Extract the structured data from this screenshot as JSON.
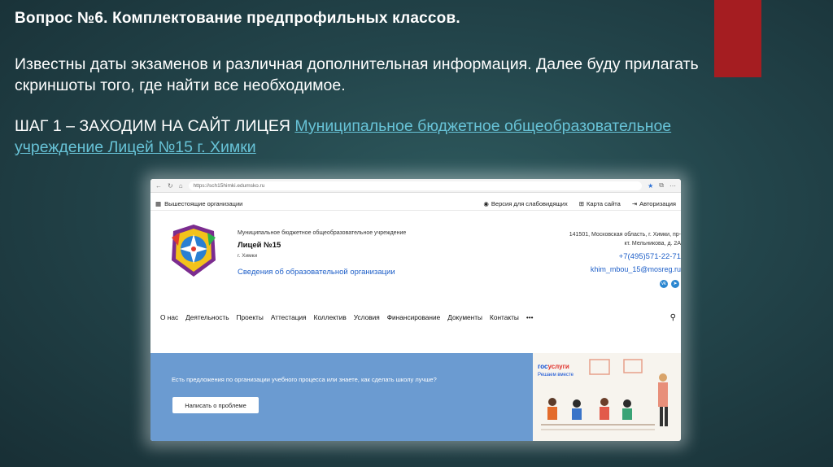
{
  "slide": {
    "title": "Вопрос №6. Комплектование предпрофильных классов.",
    "body": "Известны даты экзаменов и различная дополнительная информация. Далее буду прилагать скриншоты того, где найти все необходимое.",
    "step_prefix": "ШАГ 1 – ЗАХОДИМ НА САЙТ ЛИЦЕЯ ",
    "step_link": "Муниципальное бюджетное общеобразовательное учреждение Лицей №15 г. Химки",
    "accent_color": "#a51d21"
  },
  "browser": {
    "url": "https://sch15himki.edumsko.ru"
  },
  "site": {
    "top_strip": {
      "left": "Вышестоящие организации",
      "accessibility": "Версия для слабовидящих",
      "sitemap": "Карта сайта",
      "login": "Авторизация"
    },
    "header": {
      "org_type": "Муниципальное бюджетное общеобразовательное учреждение",
      "name": "Лицей №15",
      "city": "г. Химки",
      "info_link": "Сведения об образовательной организации",
      "address_line1": "141501, Московская область, г. Химки, пр-",
      "address_line2": "кт. Мельникова, д. 2А",
      "phone": "+7(495)571-22-71",
      "email": "khim_mbou_15@mosreg.ru"
    },
    "nav": [
      "О нас",
      "Деятельность",
      "Проекты",
      "Аттестация",
      "Коллектив",
      "Условия",
      "Финансирование",
      "Документы",
      "Контакты",
      "•••"
    ],
    "banner": {
      "question": "Есть предложения по организации учебного процесса или знаете, как сделать школу лучше?",
      "button": "Написать о проблеме",
      "gos_logo_a": "гос",
      "gos_logo_b": "услуги",
      "gos_sub": "Решаем вместе"
    }
  }
}
